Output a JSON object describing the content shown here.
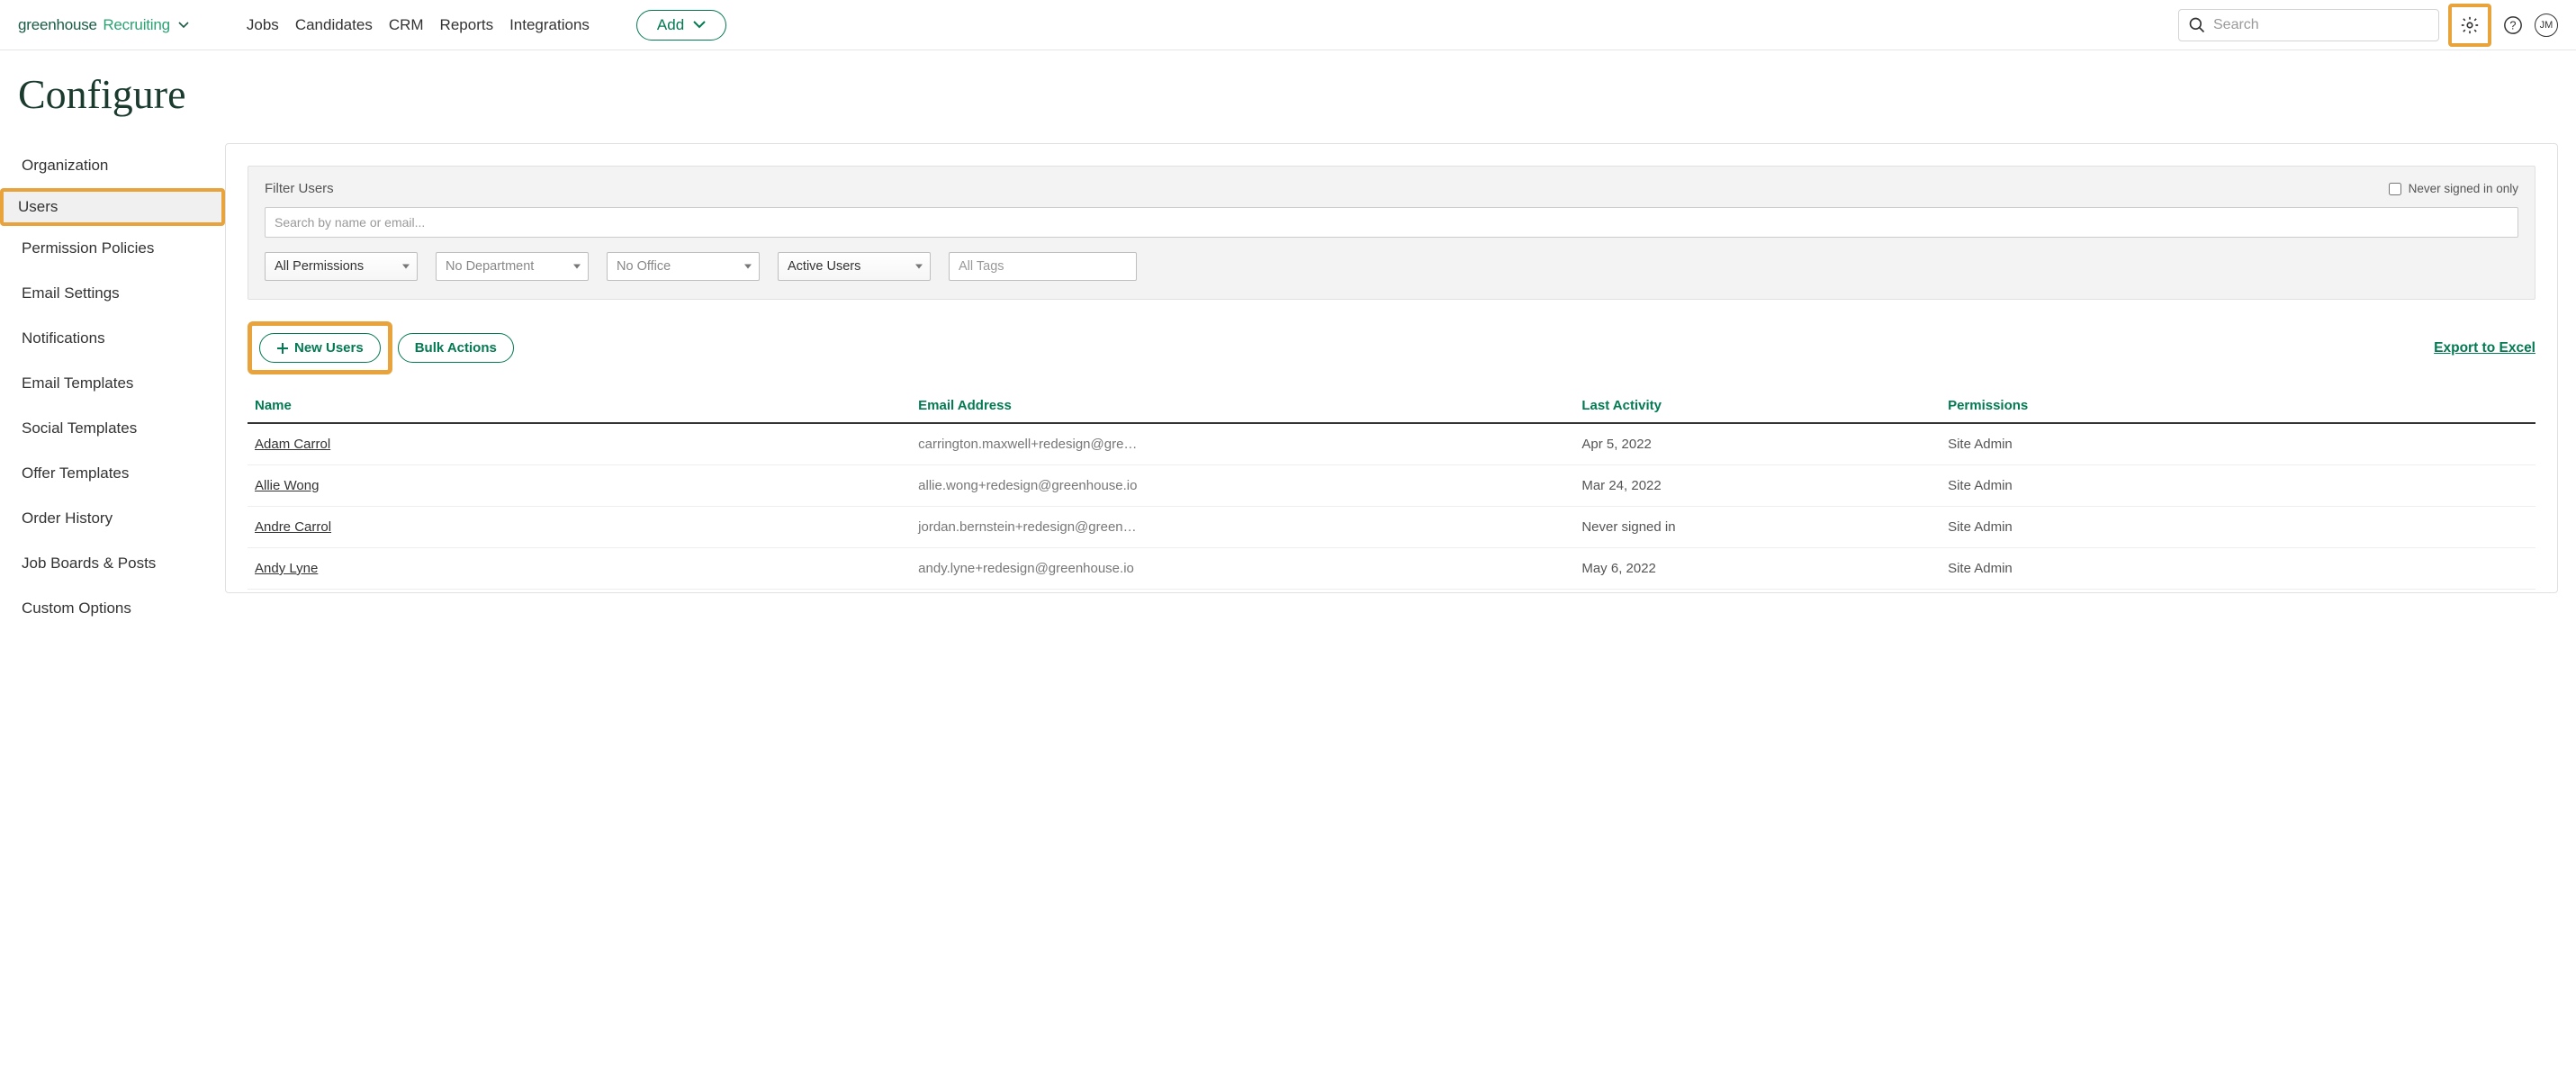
{
  "brand": {
    "part1": "greenhouse",
    "part2": "Recruiting"
  },
  "nav": {
    "jobs": "Jobs",
    "candidates": "Candidates",
    "crm": "CRM",
    "reports": "Reports",
    "integrations": "Integrations"
  },
  "add_button": "Add",
  "search_placeholder": "Search",
  "avatar_initials": "JM",
  "page_title": "Configure",
  "sidebar": {
    "items": [
      "Organization",
      "Users",
      "Permission Policies",
      "Email Settings",
      "Notifications",
      "Email Templates",
      "Social Templates",
      "Offer Templates",
      "Order History",
      "Job Boards & Posts",
      "Custom Options"
    ],
    "active_index": 1
  },
  "filter": {
    "title": "Filter Users",
    "never_signed_label": "Never signed in only",
    "search_placeholder": "Search by name or email...",
    "permissions": "All Permissions",
    "department": "No Department",
    "office": "No Office",
    "status": "Active Users",
    "tags_placeholder": "All Tags"
  },
  "actions": {
    "new_users": "New Users",
    "bulk": "Bulk Actions",
    "export": "Export to Excel"
  },
  "table": {
    "headers": {
      "name": "Name",
      "email": "Email Address",
      "last_activity": "Last Activity",
      "permissions": "Permissions"
    },
    "rows": [
      {
        "name": "Adam Carrol",
        "email": "carrington.maxwell+redesign@gre…",
        "last_activity": "Apr 5, 2022",
        "permissions": "Site Admin"
      },
      {
        "name": "Allie Wong",
        "email": "allie.wong+redesign@greenhouse.io",
        "last_activity": "Mar 24, 2022",
        "permissions": "Site Admin"
      },
      {
        "name": "Andre Carrol",
        "email": "jordan.bernstein+redesign@green…",
        "last_activity": "Never signed in",
        "permissions": "Site Admin"
      },
      {
        "name": "Andy Lyne",
        "email": "andy.lyne+redesign@greenhouse.io",
        "last_activity": "May 6, 2022",
        "permissions": "Site Admin"
      }
    ]
  }
}
